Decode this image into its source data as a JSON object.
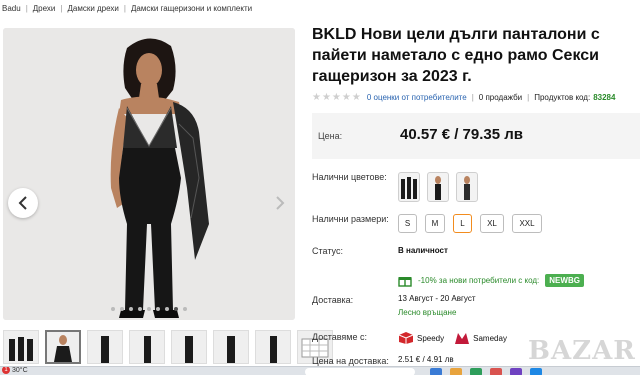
{
  "breadcrumb": [
    "Badu",
    "Дрехи",
    "Дамски дрехи",
    "Дамски гащеризони и комплекти"
  ],
  "gallery": {
    "prev_icon": "chevron-left-icon",
    "next_icon": "chevron-right-icon",
    "dot_count": 9,
    "active_dot": 7
  },
  "thumbs_count": 8,
  "product": {
    "title": "BKLD Нови цели дълги панталони с пайети наметало с едно рамо Секси гащеризон за 2023 г.",
    "ratings_link": "0 оценки от потребителите",
    "sales": "0 продажби",
    "code_label": "Продуктов код:",
    "code_value": "83284"
  },
  "price": {
    "label": "Цена:",
    "value": "40.57 € / 79.35 лв"
  },
  "labels": {
    "colors": "Налични цветове:",
    "sizes": "Налични размери:",
    "status": "Статус:",
    "delivery": "Доставка:",
    "delivery_with": "Доставяме с:",
    "shipping_price": "Цена на доставка:"
  },
  "sizes": [
    "S",
    "M",
    "L",
    "XL",
    "XXL"
  ],
  "selected_size": "L",
  "status_value": "В наличност",
  "promo": {
    "icon": "gift-icon",
    "text": "-10% за нови потребители с код:",
    "code": "NEWBG"
  },
  "delivery": {
    "dates": "13 Август - 20 Август",
    "easy_return": "Лесно връщане"
  },
  "couriers": [
    "Speedy",
    "Sameday"
  ],
  "shipping_price": "2.51 € / 4.91 лв",
  "watermark": "BAZAR",
  "taskbar": {
    "temperature": "30°C",
    "badge": "1"
  },
  "colors": {
    "green": "#2a8a2a",
    "link": "#2a64b0",
    "selected": "#f28c1e",
    "promo_bg": "#4caf50"
  }
}
